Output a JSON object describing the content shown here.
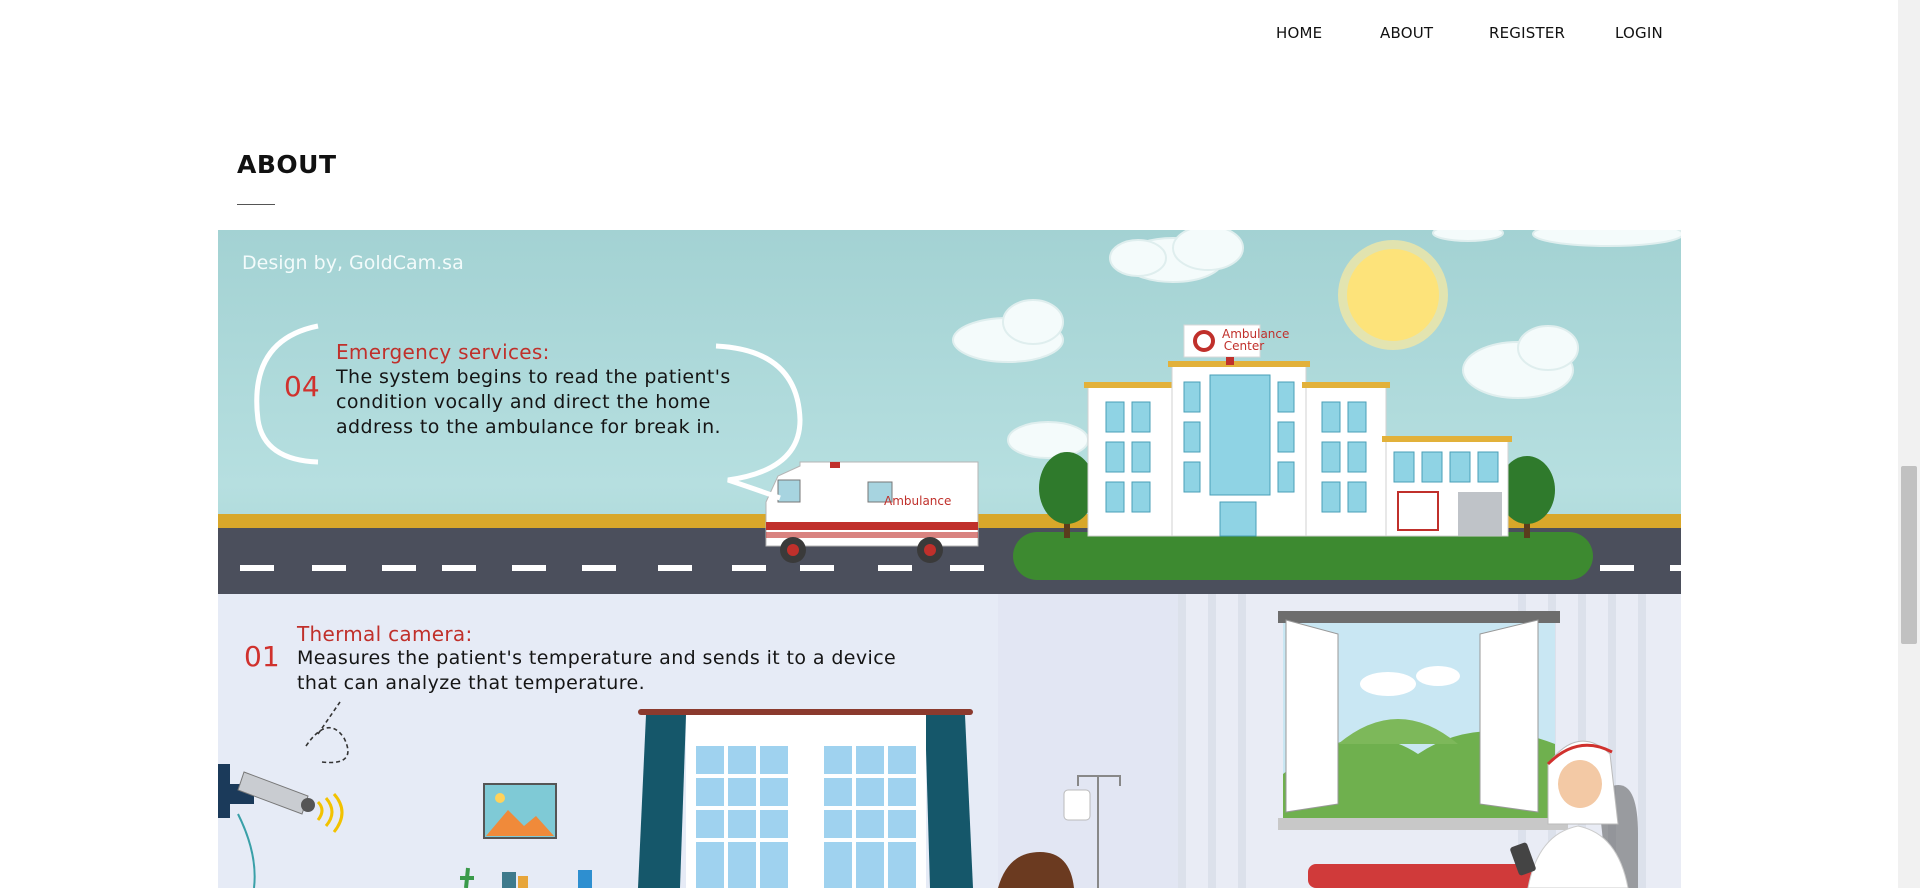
{
  "nav": {
    "items": [
      "HOME",
      "ABOUT",
      "REGISTER",
      "LOGIN"
    ]
  },
  "about": {
    "title": "ABOUT"
  },
  "illustration": {
    "credit": "Design by, GoldCam.sa",
    "steps": [
      {
        "number": "04",
        "title": "Emergency services:",
        "body": "The system begins to read the patient's\ncondition vocally and direct the home\naddress to the ambulance for break in."
      },
      {
        "number": "01",
        "title": "Thermal camera:",
        "body": "Measures the patient's temperature and sends it to a device\nthat can analyze that temperature."
      }
    ],
    "building_sign": "Ambulance Center",
    "vehicle_label": "Ambulance"
  },
  "colors": {
    "sky": "#a3d2d3",
    "road": "#4b4f5c",
    "accent_red": "#c0302b",
    "room": "#e6ebf5"
  }
}
